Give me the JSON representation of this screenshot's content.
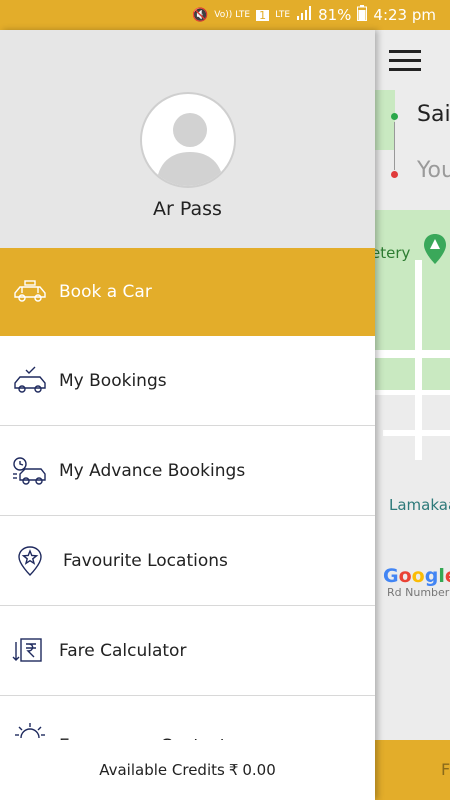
{
  "statusbar": {
    "volte": "Vo)) LTE",
    "sim": "1",
    "lte": "LTE",
    "battery": "81%",
    "time": "4:23 pm"
  },
  "map": {
    "from_text": "Sai",
    "to_text": "You",
    "cemetery_label": "etery",
    "lamakaan_label": "Lamakaa",
    "google_label": "Google",
    "road_label": "Rd Number",
    "bottom_button": "F"
  },
  "drawer": {
    "username": "Ar Pass",
    "items": [
      {
        "label": "Book a Car",
        "icon": "car-icon",
        "active": true
      },
      {
        "label": "My Bookings",
        "icon": "car-check-icon"
      },
      {
        "label": "My Advance Bookings",
        "icon": "car-clock-icon"
      },
      {
        "label": "Favourite Locations",
        "icon": "location-star-icon"
      },
      {
        "label": "Fare Calculator",
        "icon": "rupee-arrows-icon"
      },
      {
        "label": "Emergency Contact",
        "icon": "sun-icon"
      }
    ],
    "credits_label": "Available Credits",
    "currency": "₹",
    "credits_value": "0.00"
  },
  "colors": {
    "accent": "#e3ad2a",
    "header_bg": "#e6e6e6",
    "icon": "#1f2a5e"
  }
}
